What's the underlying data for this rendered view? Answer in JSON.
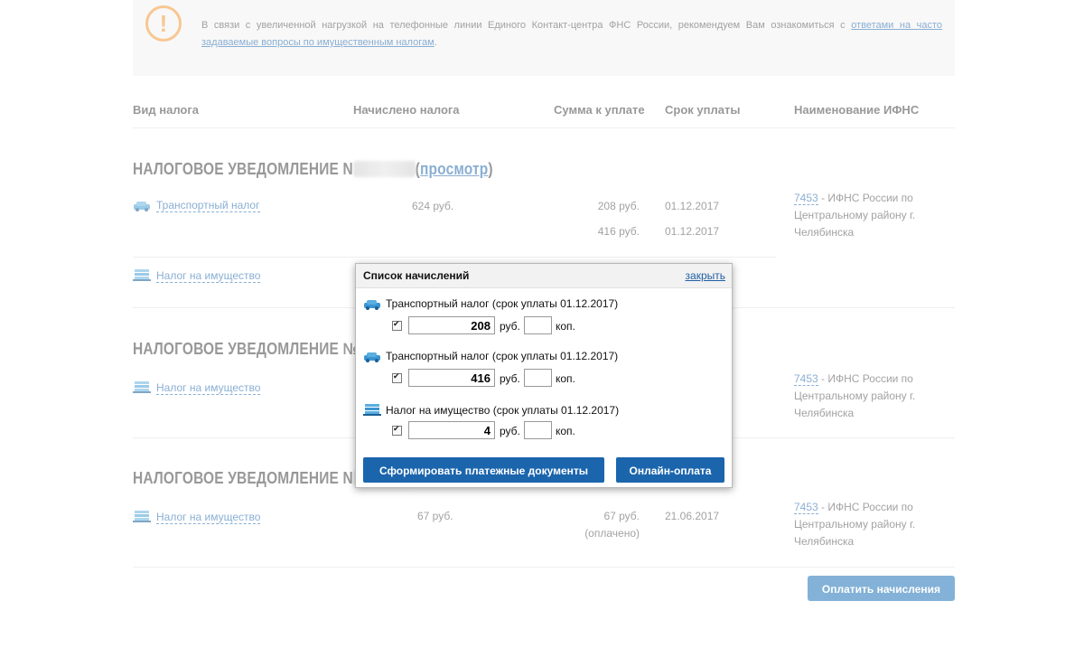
{
  "notice": {
    "text": "В связи с увеличенной нагрузкой на телефонные линии Единого Контакт-центра ФНС России, рекомендуем Вам ознакомиться с",
    "link": "ответами на часто задаваемые вопросы по имущественным налогам",
    "tail": ".",
    "color": "#f39a3a"
  },
  "table": {
    "headers": [
      "Вид налога",
      "Начислено налога",
      "Сумма к уплате",
      "Срок уплаты",
      "Наименование ИФНС"
    ]
  },
  "notifications": [
    {
      "title": "НАЛОГОВОЕ УВЕДОМЛЕНИЕ N",
      "view_paren_open": "(",
      "view_link": "просмотр",
      "view_paren_close": ")",
      "rows": [
        {
          "tax": "Транспортный налог",
          "icon": "car-icon",
          "accrued": "624 руб.",
          "payments": [
            {
              "amount": "208 руб.",
              "due": "01.12.2017"
            },
            {
              "amount": "416 руб.",
              "due": "01.12.2017"
            }
          ]
        },
        {
          "tax": "Налог на имущество",
          "icon": "building-icon"
        }
      ],
      "ifns_code": "7453",
      "ifns_name": "- ИФНС России по Центральному району г. Челябинска"
    },
    {
      "title": "НАЛОГОВОЕ УВЕДОМЛЕНИЕ №",
      "rows": [
        {
          "tax": "Налог на имущество",
          "icon": "building-icon"
        }
      ],
      "ifns_code": "7453",
      "ifns_name": "- ИФНС России по Центральному району г. Челябинска"
    },
    {
      "title": "НАЛОГОВОЕ УВЕДОМЛЕНИЕ N",
      "rows": [
        {
          "tax": "Налог на имущество",
          "icon": "building-icon",
          "accrued": "67 руб.",
          "amount": "67 руб.",
          "paid": "(оплачено)",
          "due": "21.06.2017"
        }
      ],
      "ifns_code": "7453",
      "ifns_name": "- ИФНС России по Центральному району г. Челябинска"
    }
  ],
  "pay_button": "Оплатить начисления",
  "popup": {
    "title": "Список начислений",
    "close": "закрыть",
    "rub": "руб.",
    "kop": "коп.",
    "items": [
      {
        "label": "Транспортный налог (срок уплаты 01.12.2017)",
        "icon": "car-icon",
        "rub": "208",
        "kop": "",
        "checked": true
      },
      {
        "label": "Транспортный налог (срок уплаты 01.12.2017)",
        "icon": "car-icon",
        "rub": "416",
        "kop": "",
        "checked": true
      },
      {
        "label": "Налог на имущество (срок уплаты 01.12.2017)",
        "icon": "building-icon",
        "rub": "4",
        "kop": "",
        "checked": true
      }
    ],
    "form_button": "Сформировать платежные документы",
    "online_button": "Онлайн-оплата"
  }
}
